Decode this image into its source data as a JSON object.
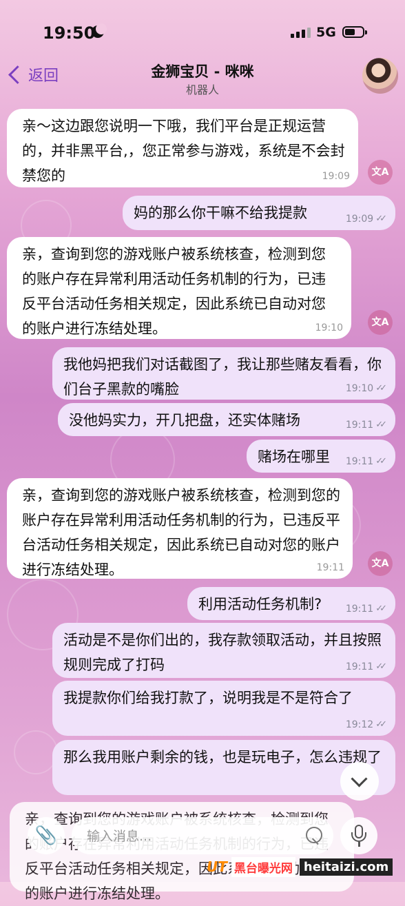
{
  "status_bar": {
    "time": "19:50",
    "network": "5G",
    "battery_level": 0.6
  },
  "header": {
    "back_label": "返回",
    "title": "金狮宝贝 - 咪咪",
    "subtitle": "机器人"
  },
  "messages": [
    {
      "dir": "in",
      "text": "亲～这边跟您说明一下哦，我们平台是正规运营的，并非黑平台,，您正常参与游戏，系统是不会封禁您的",
      "time": "19:09",
      "translate": true
    },
    {
      "dir": "out",
      "text": "妈的那么你干嘛不给我提款",
      "time": "19:09",
      "read": true
    },
    {
      "dir": "in",
      "text": "亲，查询到您的游戏账户被系统核查，检测到您的账户存在异常利用活动任务机制的行为，已违反平台活动任务相关规定，因此系统已自动对您的账户进行冻结处理。",
      "time": "19:10",
      "translate": true
    },
    {
      "dir": "out",
      "text": "我他妈把我们对话截图了，我让那些赌友看看，你们台子黑款的嘴脸",
      "time": "19:10",
      "read": true
    },
    {
      "dir": "out",
      "text": "没他妈实力，开几把盘，还实体赌场",
      "time": "19:11",
      "read": true
    },
    {
      "dir": "out",
      "text": "赌场在哪里",
      "time": "19:11",
      "read": true
    },
    {
      "dir": "in",
      "text": "亲，查询到您的游戏账户被系统核查，检测到您的账户存在异常利用活动任务机制的行为，已违反平台活动任务相关规定，因此系统已自动对您的账户进行冻结处理。",
      "time": "19:11",
      "translate": true
    },
    {
      "dir": "out",
      "text": "利用活动任务机制?",
      "time": "19:11",
      "read": true
    },
    {
      "dir": "out",
      "text": "活动是不是你们出的，我存款领取活动，并且按照规则完成了打码",
      "time": "19:11",
      "read": true
    },
    {
      "dir": "out",
      "text": "我提款你们给我打款了，说明我是不是符合了",
      "time": "19:12",
      "read": true
    },
    {
      "dir": "out",
      "text": "那么我用账户剩余的钱，也是玩电子，怎么违规了",
      "time": "",
      "read": false
    },
    {
      "dir": "in",
      "text": "亲，查询到您的游戏账户被系统核查，检测到您的账户存在异常利用活动任务机制的行为，已违反平台活动任务相关规定，因此系统已自动对您的账户进行冻结处理。",
      "time": "",
      "translate": false
    }
  ],
  "translate_icon_label": "文A",
  "input": {
    "placeholder": "输入消息..."
  },
  "watermark": {
    "logo": "UT",
    "name": "黑台曝光网",
    "url": "heitaizi.com"
  }
}
